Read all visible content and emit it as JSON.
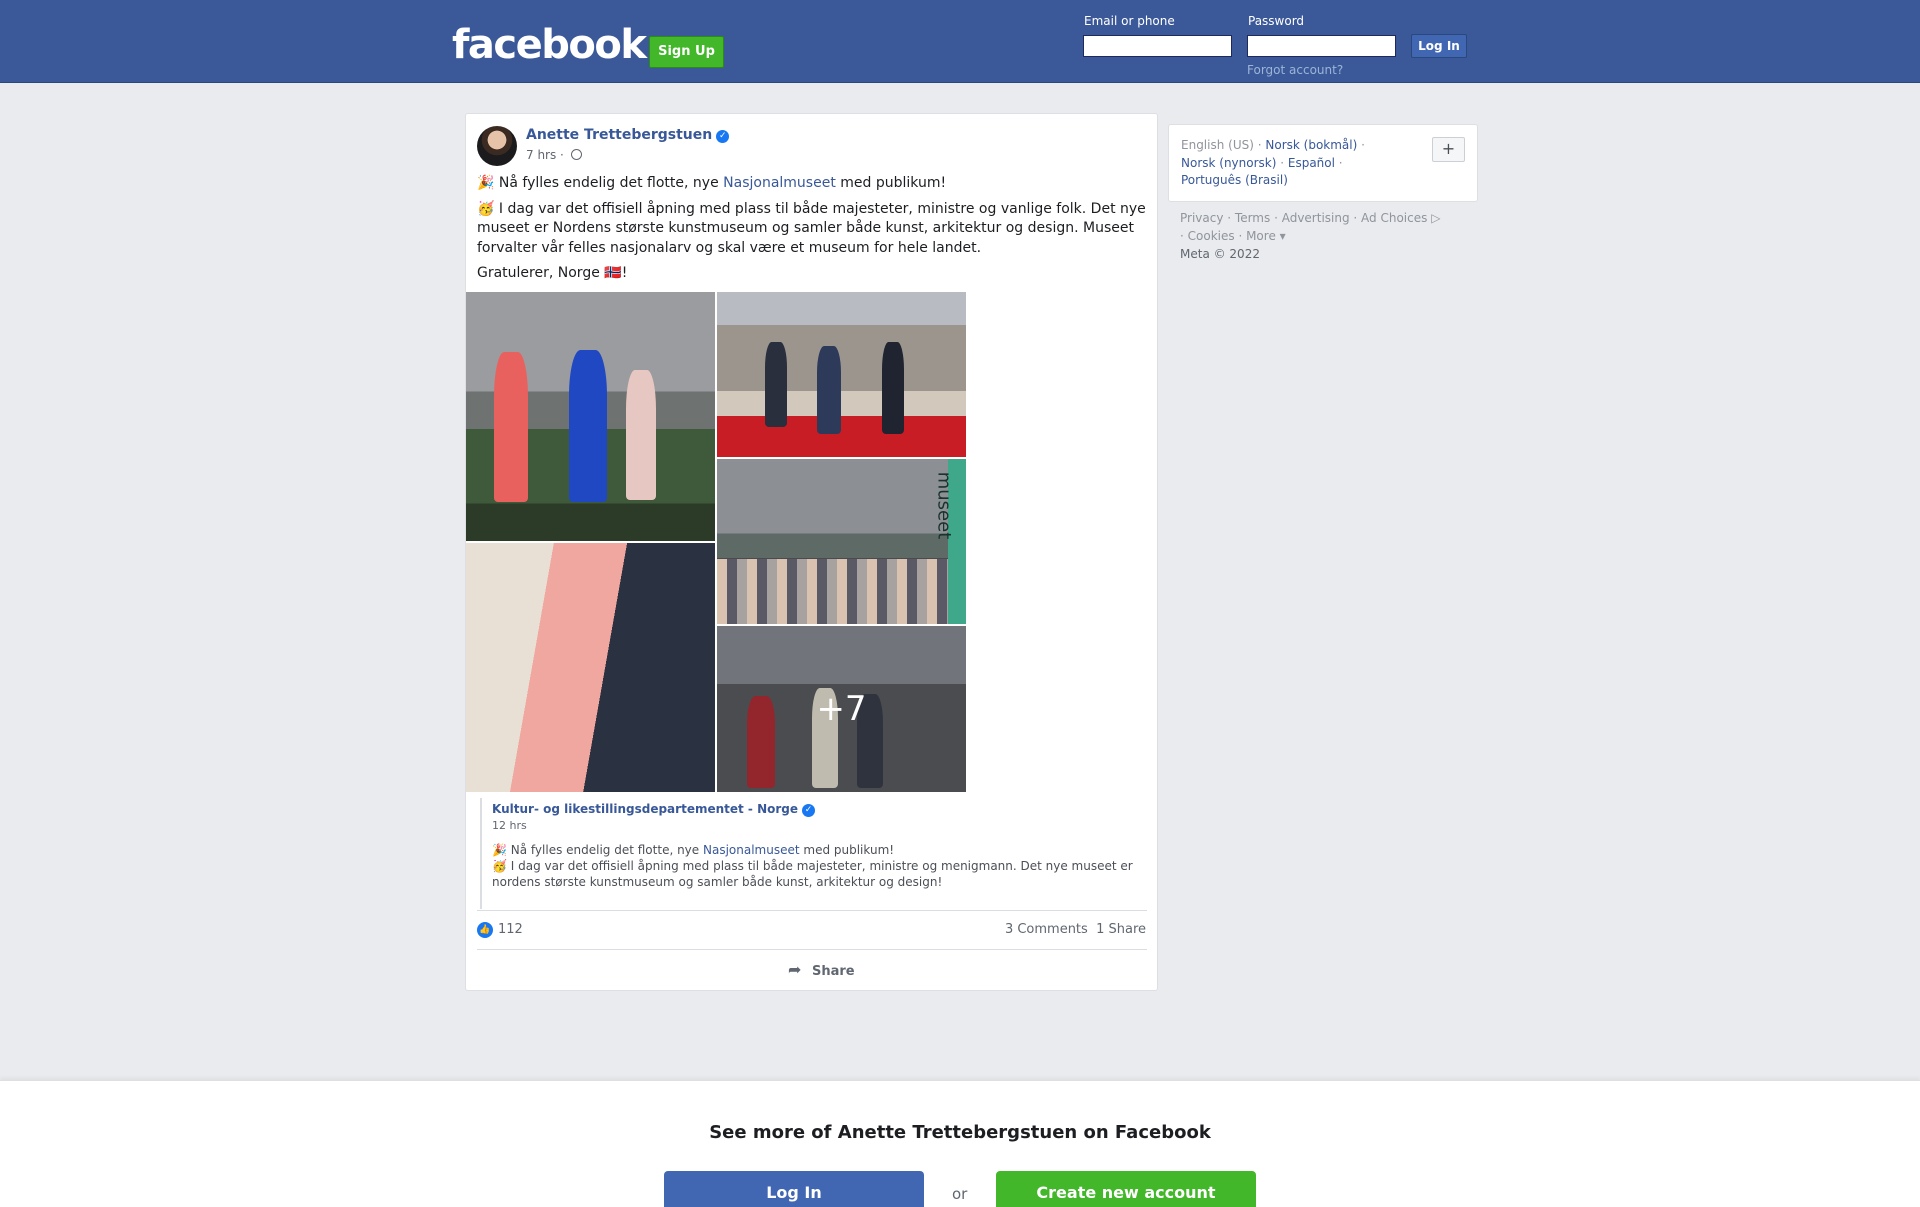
{
  "header": {
    "logo": "facebook",
    "signup_label": "Sign Up",
    "email_label": "Email or phone",
    "password_label": "Password",
    "login_label": "Log In",
    "forgot_label": "Forgot account?"
  },
  "post": {
    "author": "Anette Trettebergstuen",
    "time": "7 hrs ·",
    "line1_emoji": "🎉",
    "line1_pre": " Nå fylles endelig det flotte, nye ",
    "line1_link": "Nasjonalmuseet",
    "line1_post": " med publikum!",
    "line2_emoji": "🥳",
    "line2": " I dag var det offisiell åpning med plass til både majesteter, ministre og vanlige folk. Det nye museet er Nordens største kunstmuseum og samler både kunst, arkitektur og design. Museet forvalter vår felles nasjonalarv og skal være et museum for hele landet.",
    "line3": "Gratulerer, Norge 🇳🇴!",
    "more_photos": "+7",
    "museet_label": "museet",
    "shared": {
      "author": "Kultur- og likestillingsdepartementet - Norge",
      "time": "12 hrs",
      "line1_emoji": "🎉",
      "line1_pre": " Nå fylles endelig det flotte, nye ",
      "line1_link": "Nasjonalmuseet",
      "line1_post": " med publikum!",
      "line2_emoji": "🥳",
      "line2": " I dag var det offisiell åpning med plass til både majesteter, ministre og menigmann. Det nye museet er nordens største kunstmuseum og samler både kunst, arkitektur og design!"
    },
    "likes": "112",
    "comments": "3 Comments",
    "shares": "1 Share",
    "share_label": "Share"
  },
  "sidebar": {
    "languages": {
      "current": "English (US)",
      "norsk_bokmal": "Norsk (bokmål)",
      "norsk_nynorsk": "Norsk (nynorsk)",
      "espanol": "Español",
      "portugues": "Português (Brasil)"
    },
    "plus_label": "+",
    "footer": {
      "privacy": "Privacy",
      "terms": "Terms",
      "advertising": "Advertising",
      "ad_choices": "Ad Choices",
      "cookies": "Cookies",
      "more": "More",
      "copyright": "Meta © 2022"
    }
  },
  "banner": {
    "title": "See more of Anette Trettebergstuen on Facebook",
    "login_label": "Log In",
    "or_label": "or",
    "create_label": "Create new account"
  },
  "colors": {
    "brand_blue": "#3b5998",
    "link_blue": "#385898",
    "green": "#42b72a",
    "verified_blue": "#1877f2"
  }
}
